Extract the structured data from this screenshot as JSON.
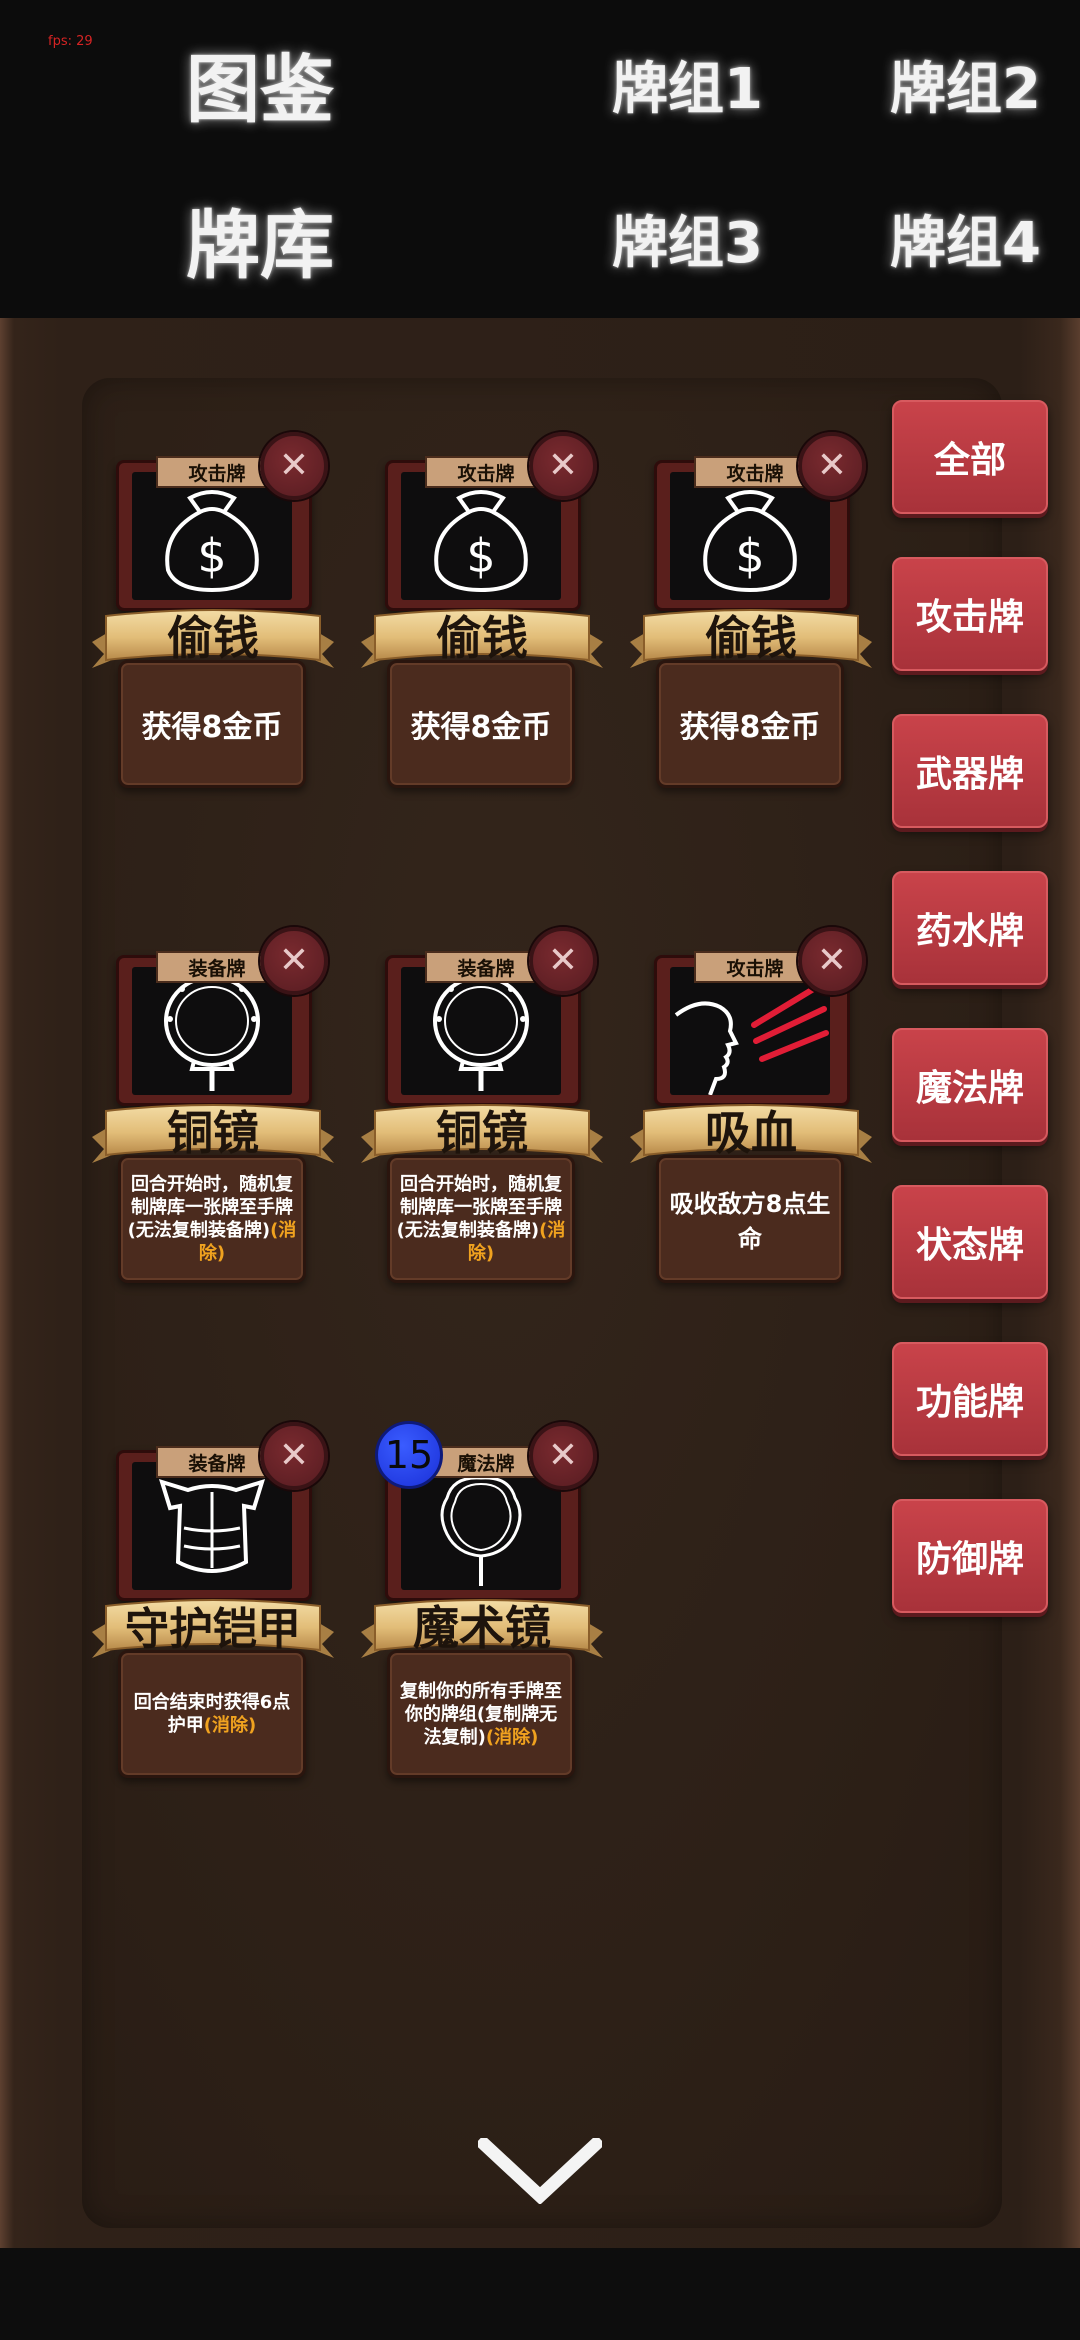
{
  "fps_text": "fps: 29",
  "tabs": {
    "collection": "图鉴",
    "library": "牌库",
    "deck1": "牌组1",
    "deck2": "牌组2",
    "deck3": "牌组3",
    "deck4": "牌组4"
  },
  "filters": [
    "全部",
    "攻击牌",
    "武器牌",
    "药水牌",
    "魔法牌",
    "状态牌",
    "功能牌",
    "防御牌"
  ],
  "cards": [
    {
      "type": "攻击牌",
      "name": "偷钱",
      "desc": "获得8金币",
      "icon": "money-bag-icon"
    },
    {
      "type": "攻击牌",
      "name": "偷钱",
      "desc": "获得8金币",
      "icon": "money-bag-icon"
    },
    {
      "type": "攻击牌",
      "name": "偷钱",
      "desc": "获得8金币",
      "icon": "money-bag-icon"
    },
    {
      "type": "装备牌",
      "name": "铜镜",
      "desc": "回合开始时，随机复制牌库一张牌至手牌(无法复制装备牌)",
      "keyword": "(消除)",
      "icon": "bronze-mirror-icon"
    },
    {
      "type": "装备牌",
      "name": "铜镜",
      "desc": "回合开始时，随机复制牌库一张牌至手牌(无法复制装备牌)",
      "keyword": "(消除)",
      "icon": "bronze-mirror-icon"
    },
    {
      "type": "攻击牌",
      "name": "吸血",
      "desc": "吸收敌方8点生命",
      "icon": "vampire-bite-icon"
    },
    {
      "type": "装备牌",
      "name": "守护铠甲",
      "desc": "回合结束时获得6点护甲",
      "keyword": "(消除)",
      "icon": "armor-icon"
    },
    {
      "type": "魔法牌",
      "name": "魔术镜",
      "desc": "复制你的所有手牌至你的牌组(复制牌无法复制)",
      "keyword": "(消除)",
      "icon": "magic-mirror-icon",
      "count": "15"
    }
  ],
  "close_glyph": "✕",
  "colors": {
    "accent_red": "#b93a41",
    "keyword_orange": "#f0a21f",
    "badge_blue": "#2a44ee"
  }
}
